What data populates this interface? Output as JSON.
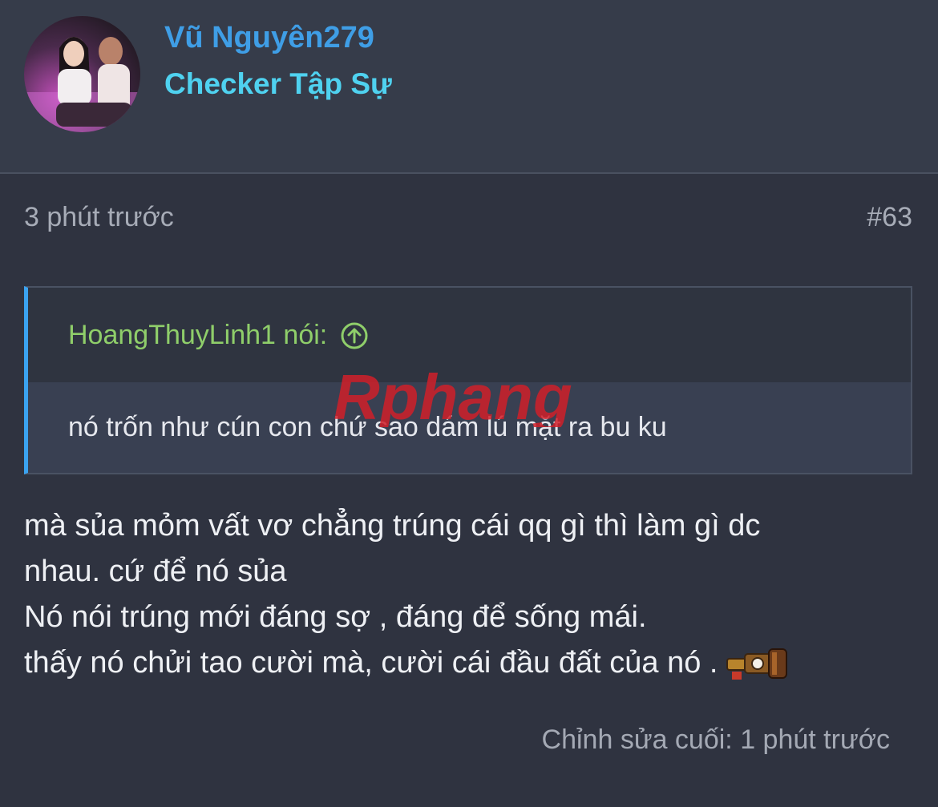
{
  "user": {
    "name": "Vũ Nguyên279",
    "title": "Checker Tập Sự"
  },
  "post": {
    "time": "3 phút trước",
    "number": "#63",
    "quote": {
      "author_label": "HoangThuyLinh1 nói:",
      "text": "nó trốn như cún con chứ sao dám lú mặt ra bu ku"
    },
    "message_lines": [
      "mà sủa mỏm vất vơ chẳng trúng cái qq gì thì làm gì dc",
      "nhau. cứ để nó sủa",
      "Nó nói trúng mới đáng sợ , đáng để sống mái.",
      "thấy nó chửi tao cười mà, cười cái đầu đất của nó ."
    ],
    "edited": "Chỉnh sửa cuối: 1 phút trước"
  },
  "watermark": {
    "text": "Rphang"
  },
  "colors": {
    "background": "#2f3340",
    "header_background": "#363c4a",
    "username": "#3f9ee6",
    "user_title": "#4fd2f0",
    "quote_author": "#8fce6a",
    "quote_accent": "#3ba3f0",
    "muted_text": "#a7acb7"
  },
  "icons": {
    "quote_jump": "arrow-up-circle-icon",
    "emoji": "gun-emoji-icon"
  }
}
